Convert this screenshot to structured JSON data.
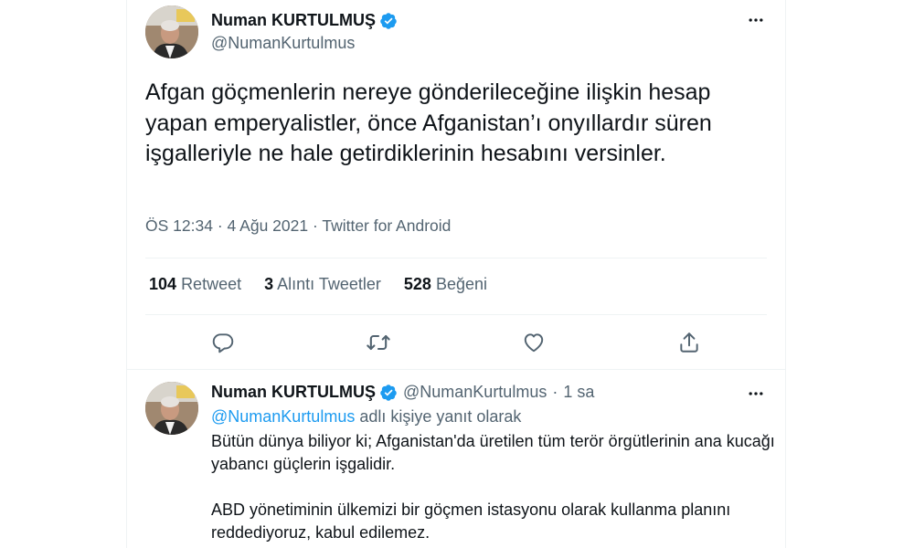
{
  "main_tweet": {
    "author_name": "Numan KURTULMUŞ",
    "author_handle": "@NumanKurtulmus",
    "text": "Afgan göçmenlerin nereye gönderileceğine ilişkin hesap yapan emperyalistler, önce Afganistan’ı onyıllardır süren işgalleriyle ne hale getirdiklerinin hesabını versinler.",
    "time": "ÖS 12:34",
    "date": "4 Ağu 2021",
    "source": "Twitter for Android",
    "separator": "·",
    "stats": [
      {
        "count": "104",
        "label": "Retweet"
      },
      {
        "count": "3",
        "label": "Alıntı Tweetler"
      },
      {
        "count": "528",
        "label": "Beğeni"
      }
    ]
  },
  "reply_tweet": {
    "author_name": "Numan KURTULMUŞ",
    "author_handle": "@NumanKurtulmus",
    "separator": "·",
    "time_ago": "1 sa",
    "reply_mention": "@NumanKurtulmus",
    "reply_suffix": "adlı kişiye yanıt olarak",
    "paragraphs": [
      "Bütün dünya biliyor ki; Afganistan'da üretilen tüm terör örgütlerinin ana kucağı yabancı güçlerin işgalidir.",
      "ABD yönetiminin ülkemizi bir göçmen istasyonu olarak kullanma planını reddediyoruz, kabul edilemez."
    ]
  },
  "icons": {
    "verified": "verified-badge-icon",
    "more": "more-options-icon",
    "reply": "reply-icon",
    "retweet": "retweet-icon",
    "like": "like-icon",
    "share": "share-icon"
  },
  "colors": {
    "accent": "#1d9bf0",
    "text_primary": "#0f1419",
    "text_secondary": "#536471",
    "divider": "#eff3f4"
  }
}
